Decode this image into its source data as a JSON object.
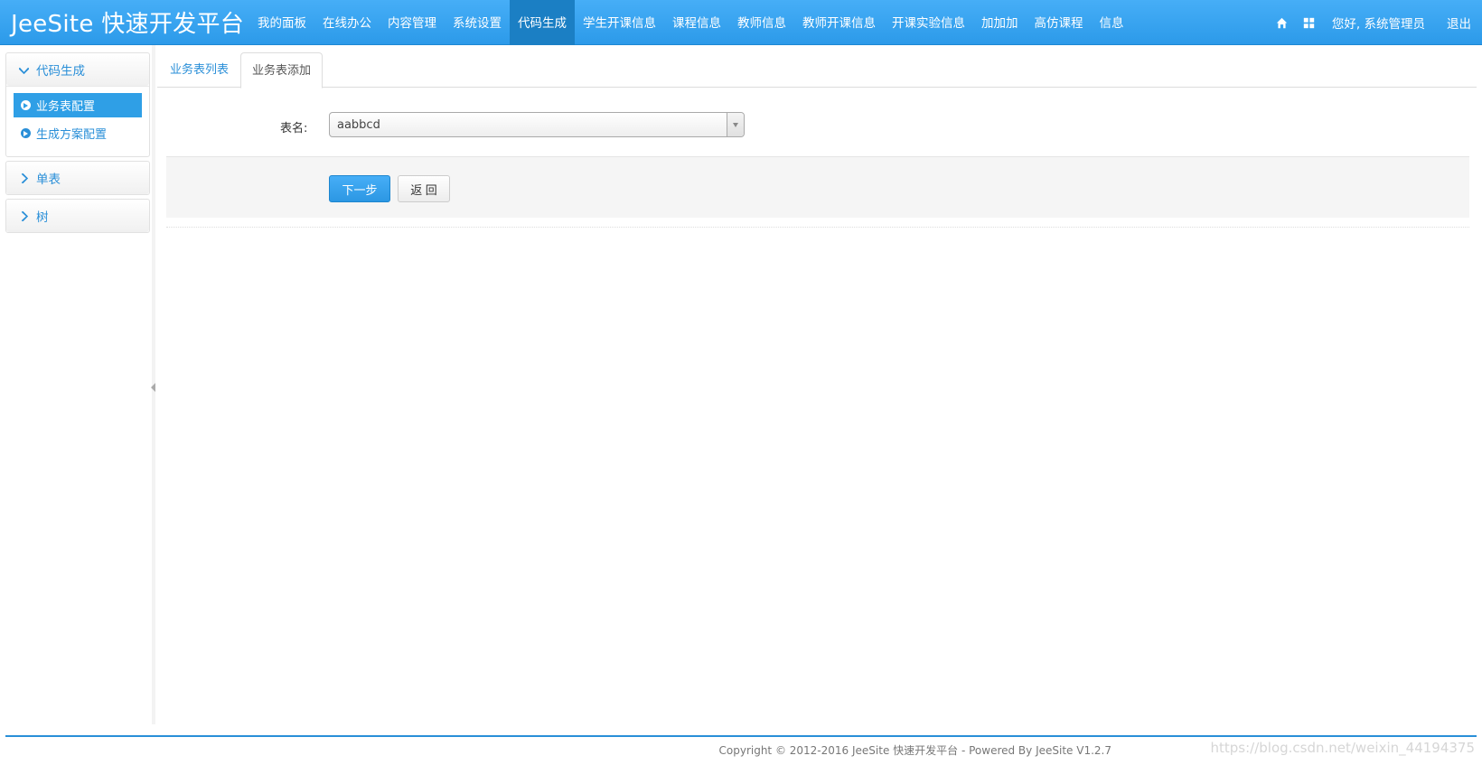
{
  "header": {
    "brand": "JeeSite 快速开发平台",
    "nav": [
      "我的面板",
      "在线办公",
      "内容管理",
      "系统设置",
      "代码生成",
      "学生开课信息",
      "课程信息",
      "教师信息",
      "教师开课信息",
      "开课实验信息",
      "加加加",
      "高仿课程",
      "信息"
    ],
    "active_nav": "代码生成",
    "home_icon": "home-icon",
    "grid_icon": "grid-icon",
    "user_greeting": "您好, 系统管理员",
    "logout": "退出"
  },
  "sidebar": {
    "group_code_gen": {
      "title": "代码生成",
      "items": [
        "业务表配置",
        "生成方案配置"
      ],
      "active_item": "业务表配置"
    },
    "group_single": {
      "title": "单表"
    },
    "group_tree": {
      "title": "树"
    }
  },
  "tabs": {
    "list": "业务表列表",
    "add": "业务表添加",
    "active": "业务表添加"
  },
  "form": {
    "table_label": "表名:",
    "table_value": "aabbcd"
  },
  "buttons": {
    "next": "下一步",
    "back": "返 回"
  },
  "footer": {
    "copyright": "Copyright © 2012-2016 JeeSite 快速开发平台 - Powered By JeeSite V1.2.7",
    "watermark": "https://blog.csdn.net/weixin_44194375"
  },
  "colors": {
    "primary": "#2c9ae9",
    "active_nav": "#1b7fc4",
    "link": "#2a8fd8"
  }
}
